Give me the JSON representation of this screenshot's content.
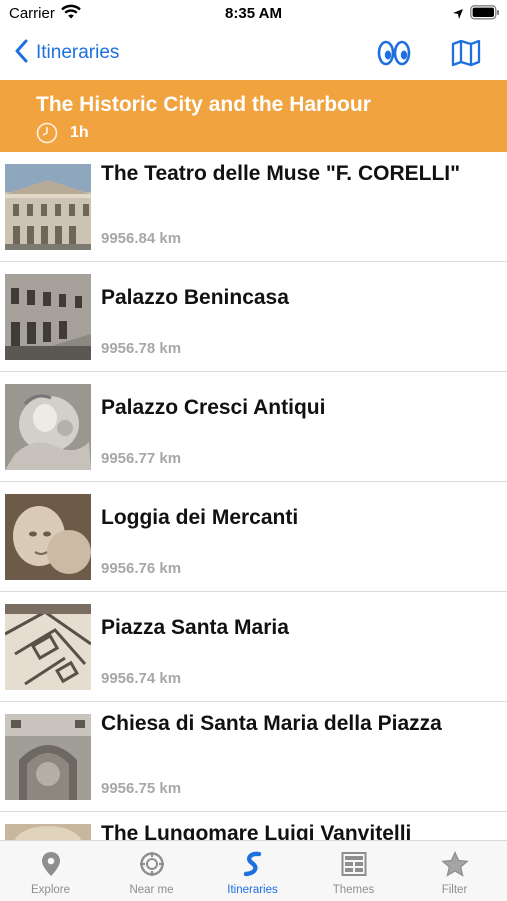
{
  "status_bar": {
    "carrier": "Carrier",
    "time": "8:35 AM"
  },
  "nav": {
    "back_label": "Itineraries"
  },
  "itinerary": {
    "title": "The Historic City and the Harbour",
    "duration": "1h"
  },
  "items": [
    {
      "title": "The Teatro delle Muse \"F. CORELLI\"",
      "distance": "9956.84 km"
    },
    {
      "title": "Palazzo Benincasa",
      "distance": "9956.78 km"
    },
    {
      "title": "Palazzo Cresci Antiqui",
      "distance": "9956.77 km"
    },
    {
      "title": "Loggia dei Mercanti",
      "distance": "9956.76 km"
    },
    {
      "title": "Piazza Santa Maria",
      "distance": "9956.74 km"
    },
    {
      "title": "Chiesa di Santa Maria della Piazza",
      "distance": "9956.75 km"
    },
    {
      "title": "The Lungomare Luigi Vanvitelli",
      "distance": ""
    }
  ],
  "tabs": [
    {
      "label": "Explore",
      "icon": "location-pin-icon"
    },
    {
      "label": "Near me",
      "icon": "compass-icon"
    },
    {
      "label": "Itineraries",
      "icon": "itinerary-path-icon"
    },
    {
      "label": "Themes",
      "icon": "themes-grid-icon"
    },
    {
      "label": "Filter",
      "icon": "star-icon"
    }
  ],
  "colors": {
    "accent": "#1e6fe0",
    "header": "#f0a33f",
    "distance": "#a7a7a7"
  }
}
